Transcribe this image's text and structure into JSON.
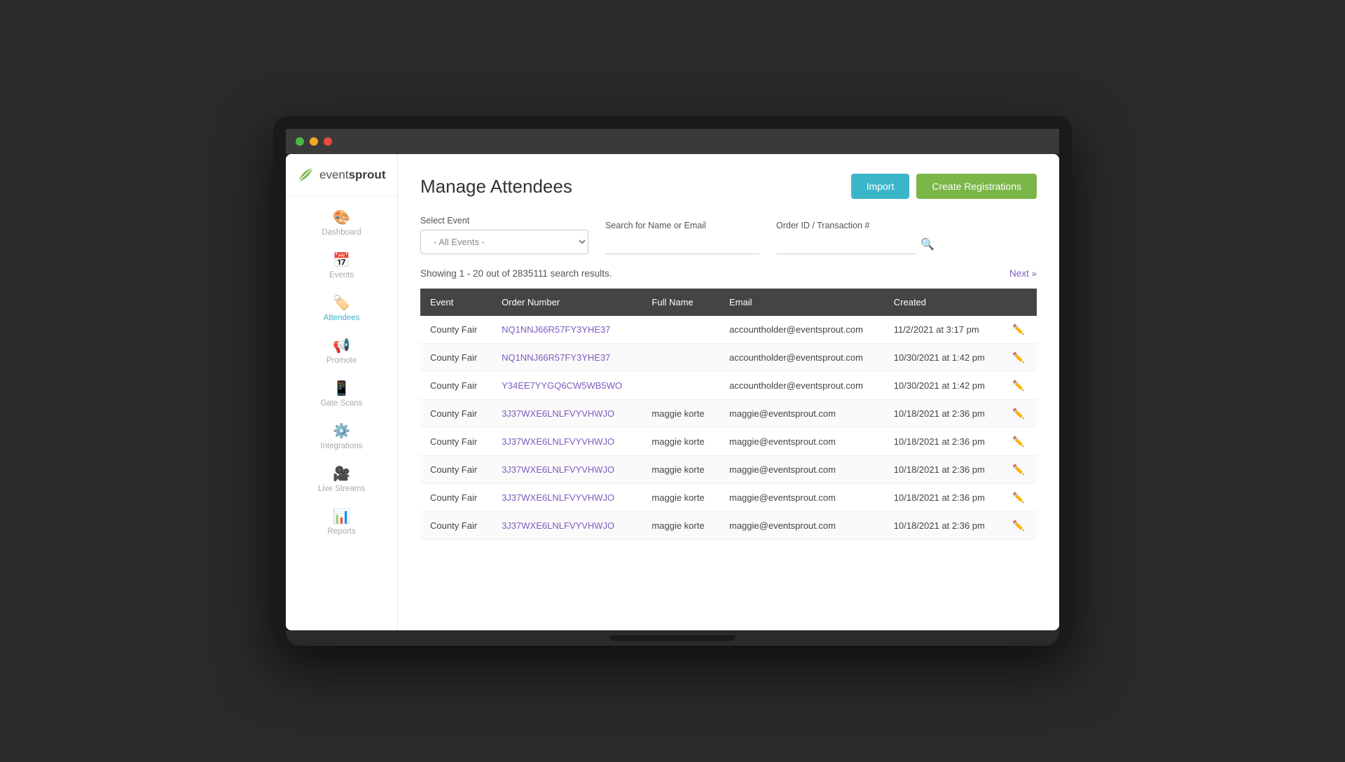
{
  "app": {
    "name": "eventsprout"
  },
  "titlebar": {
    "dots": [
      "green",
      "yellow",
      "red"
    ]
  },
  "sidebar": {
    "logo": {
      "text_event": "event",
      "text_sprout": "sprout"
    },
    "nav_items": [
      {
        "id": "dashboard",
        "label": "Dashboard",
        "icon": "🎨",
        "active": false
      },
      {
        "id": "events",
        "label": "Events",
        "icon": "📅",
        "active": false
      },
      {
        "id": "attendees",
        "label": "Attendees",
        "icon": "🏷️",
        "active": true
      },
      {
        "id": "promote",
        "label": "Promote",
        "icon": "📢",
        "active": false
      },
      {
        "id": "gate-scans",
        "label": "Gate Scans",
        "icon": "📱",
        "active": false
      },
      {
        "id": "integrations",
        "label": "Integrations",
        "icon": "⚙️",
        "active": false
      },
      {
        "id": "live-streams",
        "label": "Live Streams",
        "icon": "🎥",
        "active": false
      },
      {
        "id": "reports",
        "label": "Reports",
        "icon": "📊",
        "active": false
      }
    ]
  },
  "page": {
    "title": "Manage Attendees",
    "import_button": "Import",
    "create_button": "Create Registrations"
  },
  "filters": {
    "select_event_label": "Select Event",
    "select_event_placeholder": "- All Events -",
    "search_label": "Search for Name or Email",
    "search_placeholder": "",
    "order_id_label": "Order ID / Transaction #",
    "order_id_placeholder": ""
  },
  "results": {
    "showing_prefix": "Showing ",
    "range": "1 - 20 out of 2835111",
    "showing_suffix": " search results.",
    "next_label": "Next »"
  },
  "table": {
    "columns": [
      "Event",
      "Order Number",
      "Full Name",
      "Email",
      "Created"
    ],
    "rows": [
      {
        "event": "County Fair",
        "order": "NQ1NNJ66R57FY3YHE37",
        "name": "",
        "email": "accountholder@eventsprout.com",
        "created": "11/2/2021 at 3:17 pm"
      },
      {
        "event": "County Fair",
        "order": "NQ1NNJ66R57FY3YHE37",
        "name": "",
        "email": "accountholder@eventsprout.com",
        "created": "10/30/2021 at 1:42 pm"
      },
      {
        "event": "County Fair",
        "order": "Y34EE7YYGQ6CW5WB5WO",
        "name": "",
        "email": "accountholder@eventsprout.com",
        "created": "10/30/2021 at 1:42 pm"
      },
      {
        "event": "County Fair",
        "order": "3J37WXE6LNLFVYVHWJO",
        "name": "maggie korte",
        "email": "maggie@eventsprout.com",
        "created": "10/18/2021 at 2:36 pm"
      },
      {
        "event": "County Fair",
        "order": "3J37WXE6LNLFVYVHWJO",
        "name": "maggie korte",
        "email": "maggie@eventsprout.com",
        "created": "10/18/2021 at 2:36 pm"
      },
      {
        "event": "County Fair",
        "order": "3J37WXE6LNLFVYVHWJO",
        "name": "maggie korte",
        "email": "maggie@eventsprout.com",
        "created": "10/18/2021 at 2:36 pm"
      },
      {
        "event": "County Fair",
        "order": "3J37WXE6LNLFVYVHWJO",
        "name": "maggie korte",
        "email": "maggie@eventsprout.com",
        "created": "10/18/2021 at 2:36 pm"
      },
      {
        "event": "County Fair",
        "order": "3J37WXE6LNLFVYVHWJO",
        "name": "maggie korte",
        "email": "maggie@eventsprout.com",
        "created": "10/18/2021 at 2:36 pm"
      }
    ]
  }
}
